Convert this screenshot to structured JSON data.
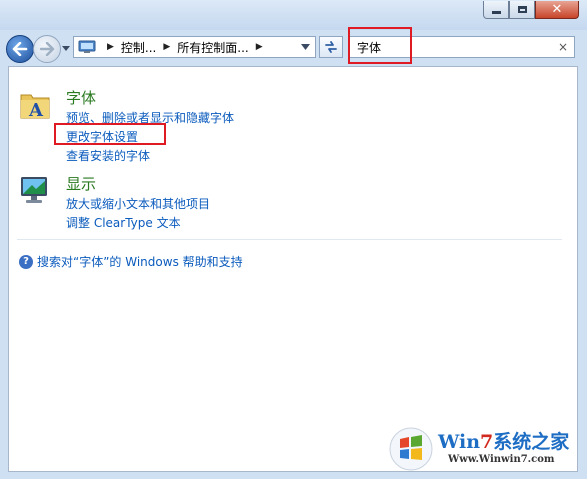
{
  "window": {
    "minimize_icon": "minimize-icon",
    "maximize_icon": "maximize-icon",
    "close_icon": "close-icon",
    "close_glyph": "✕"
  },
  "toolbar": {
    "back_icon": "back-arrow-icon",
    "forward_icon": "forward-arrow-icon",
    "breadcrumb": [
      "控制...",
      "所有控制面..."
    ],
    "refresh_icon": "refresh-icon",
    "search_value": "字体",
    "search_clear": "×"
  },
  "results": [
    {
      "icon": "fonts-folder-icon",
      "title": "字体",
      "links": [
        "预览、删除或者显示和隐藏字体",
        "更改字体设置",
        "查看安装的字体"
      ]
    },
    {
      "icon": "display-monitor-icon",
      "title": "显示",
      "links": [
        "放大或缩小文本和其他项目",
        "调整 ClearType 文本"
      ]
    }
  ],
  "help": {
    "icon": "help-icon",
    "glyph": "?",
    "text": "搜索对“字体”的 Windows 帮助和支持"
  },
  "highlight_color": "#e01a22",
  "watermark": {
    "brand_prefix": "Win",
    "brand_seven": "7",
    "brand_suffix": "系统之家",
    "url": "Www.Winwin7.com"
  }
}
